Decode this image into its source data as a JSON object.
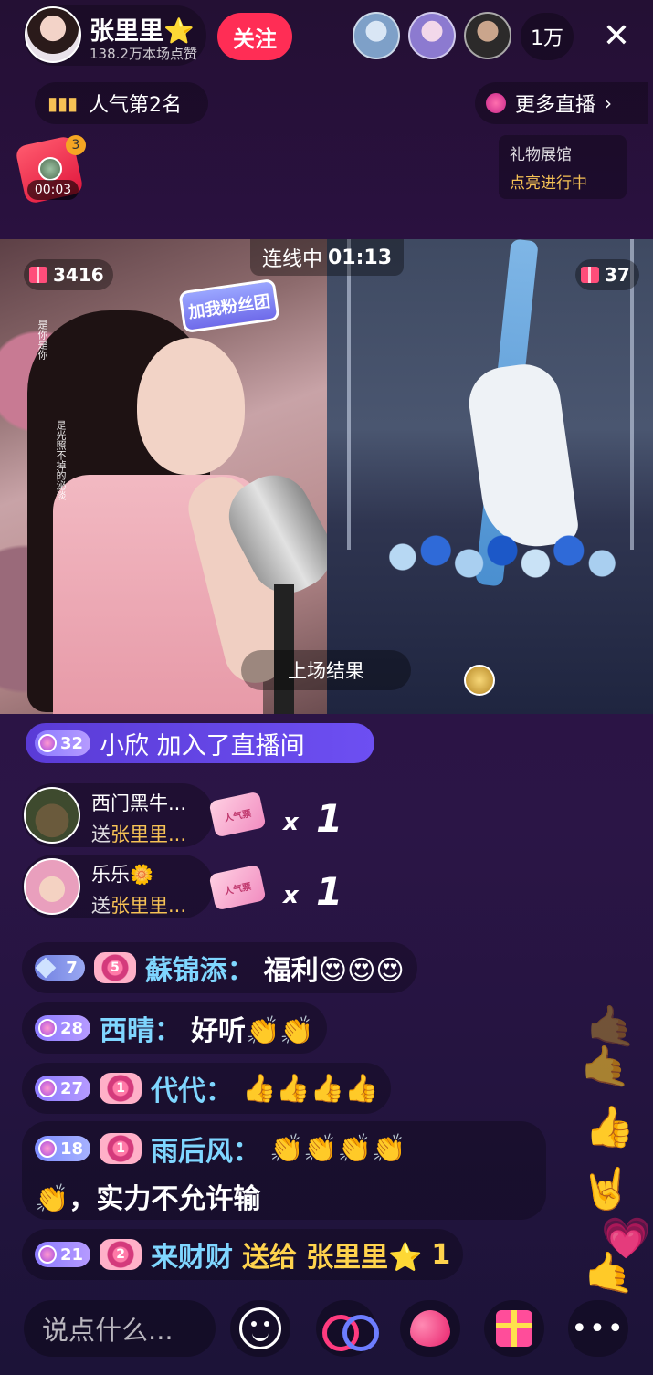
{
  "host": {
    "name": "张里里⭐",
    "likes": "138.2万本场点赞",
    "follow_label": "关注"
  },
  "viewers": {
    "count": "1万"
  },
  "rank": {
    "label": "人气第2名"
  },
  "more_live": {
    "label": "更多直播"
  },
  "gift_hall": {
    "title": "礼物展馆",
    "status": "点亮进行中"
  },
  "red_packet": {
    "time": "00:03",
    "badge": "3"
  },
  "pk": {
    "left_score": "3416",
    "right_score": "37",
    "status_label": "连线中",
    "timer": "01:13",
    "result_label": "上场结果",
    "fan_badge": "加我粉丝团"
  },
  "video_captions": {
    "caption_1": "是你是你",
    "caption_2": "是光照不掉的泌淡"
  },
  "join_notice": {
    "level": "32",
    "text": "小欣 加入了直播间"
  },
  "gift_events": [
    {
      "user": "西门黑牛...",
      "to_prefix": "送",
      "to_name": "张里里...",
      "gift_label": "人气票",
      "x": "x",
      "count": "1"
    },
    {
      "user": "乐乐🌼",
      "to_prefix": "送",
      "to_name": "张里里...",
      "gift_label": "人气票",
      "x": "x",
      "count": "1"
    }
  ],
  "messages": [
    {
      "level": "7",
      "fan_level": "5",
      "user": "蘇锦添：",
      "text": "福利😍😍😍"
    },
    {
      "level": "28",
      "user": "西晴：",
      "text": "好听👏👏"
    },
    {
      "level": "27",
      "fan_level": "1",
      "user": "代代：",
      "text": "👍👍👍👍"
    },
    {
      "level": "18",
      "fan_level": "1",
      "user": "雨后风：",
      "text": "👏👏👏👏",
      "text2": "👏，实力不允许输"
    },
    {
      "level": "21",
      "fan_level": "2",
      "user": "来财财",
      "sent": "送给",
      "recipient": "张里里⭐",
      "count": "1"
    }
  ],
  "reactions": [
    "🤙",
    "👍",
    "🤘",
    "💗",
    "🤙"
  ],
  "bottom_bar": {
    "input_placeholder": "说点什么...",
    "more_label": "•••"
  },
  "colors": {
    "follow": "#ff2d55",
    "username": "#7fd6ff",
    "gold": "#ffd34d"
  }
}
